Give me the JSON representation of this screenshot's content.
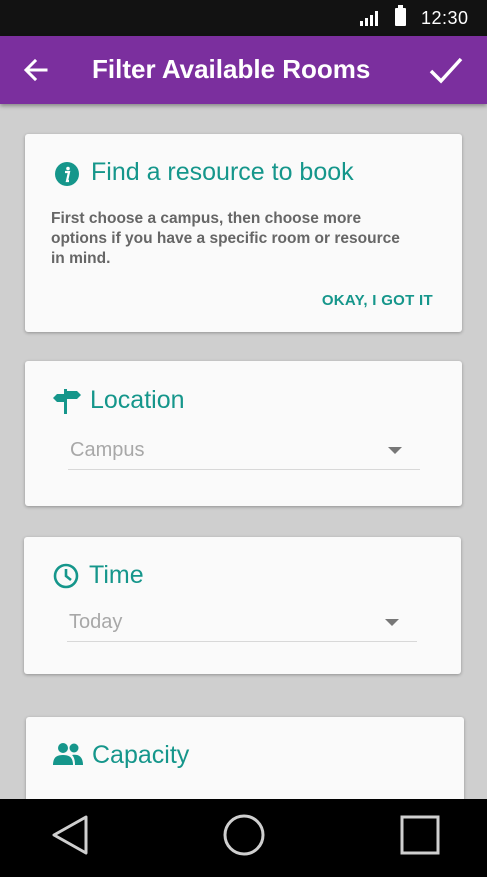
{
  "status_bar": {
    "time": "12:30",
    "icons": [
      "signal-icon",
      "battery-icon"
    ]
  },
  "app_bar": {
    "title": "Filter Available Rooms",
    "back_icon": "arrow-back-icon",
    "confirm_icon": "check-icon",
    "color": "#7b2f9e"
  },
  "info_card": {
    "icon": "info-icon",
    "title": "Find a resource to book",
    "body_lines": [
      "First choose a campus, then choose more",
      "options if you have a specific room or resource",
      "in mind."
    ],
    "action_label": "OKAY, I GOT IT"
  },
  "location_card": {
    "icon": "signpost-icon",
    "title": "Location",
    "select_value": "Campus"
  },
  "time_card": {
    "icon": "clock-icon",
    "title": "Time",
    "select_value": "Today"
  },
  "capacity_card": {
    "icon": "people-icon",
    "title": "Capacity"
  },
  "nav_bar": {
    "buttons": [
      "back-triangle-icon",
      "home-circle-icon",
      "recents-square-icon"
    ]
  },
  "accent_color": "#15968b"
}
